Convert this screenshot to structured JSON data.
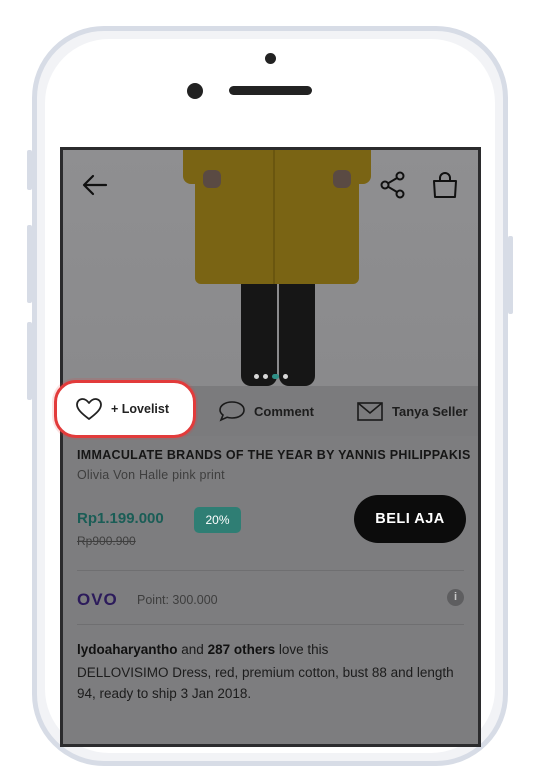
{
  "header": {
    "back_icon": "arrow-left-icon",
    "share_icon": "share-icon",
    "cart_icon": "shopping-bag-icon"
  },
  "carousel": {
    "dot_count": 4,
    "active_index": 2,
    "accent_color": "#2e8f86"
  },
  "actions": {
    "lovelist_label": "+ Lovelist",
    "comment_label": "Comment",
    "ask_seller_label": "Tanya Seller"
  },
  "product": {
    "title": "IMMACULATE BRANDS OF THE YEAR BY YANNIS PHILIPPAKIS -",
    "subtitle": "Olivia Von Halle pink print",
    "price": "Rp1.199.000",
    "discount": "20%",
    "old_price": "Rp900.900",
    "buy_label": "BELI AJA"
  },
  "ovo": {
    "logo": "OVO",
    "points": "Point: 300.000"
  },
  "social": {
    "user": "lydoaharyantho",
    "and_text": " and ",
    "others": "287 others",
    "love_text": " love ",
    "this_text": "this",
    "description": "DELLOVISIMO Dress, red, premium cotton, bust 88 and length 94, ready to ship 3 Jan 2018."
  },
  "colors": {
    "highlight_border": "#e23b3b",
    "price_green": "#1a5d56",
    "discount_bg": "#2f7e74",
    "ovo_purple": "#2c1b5b"
  }
}
